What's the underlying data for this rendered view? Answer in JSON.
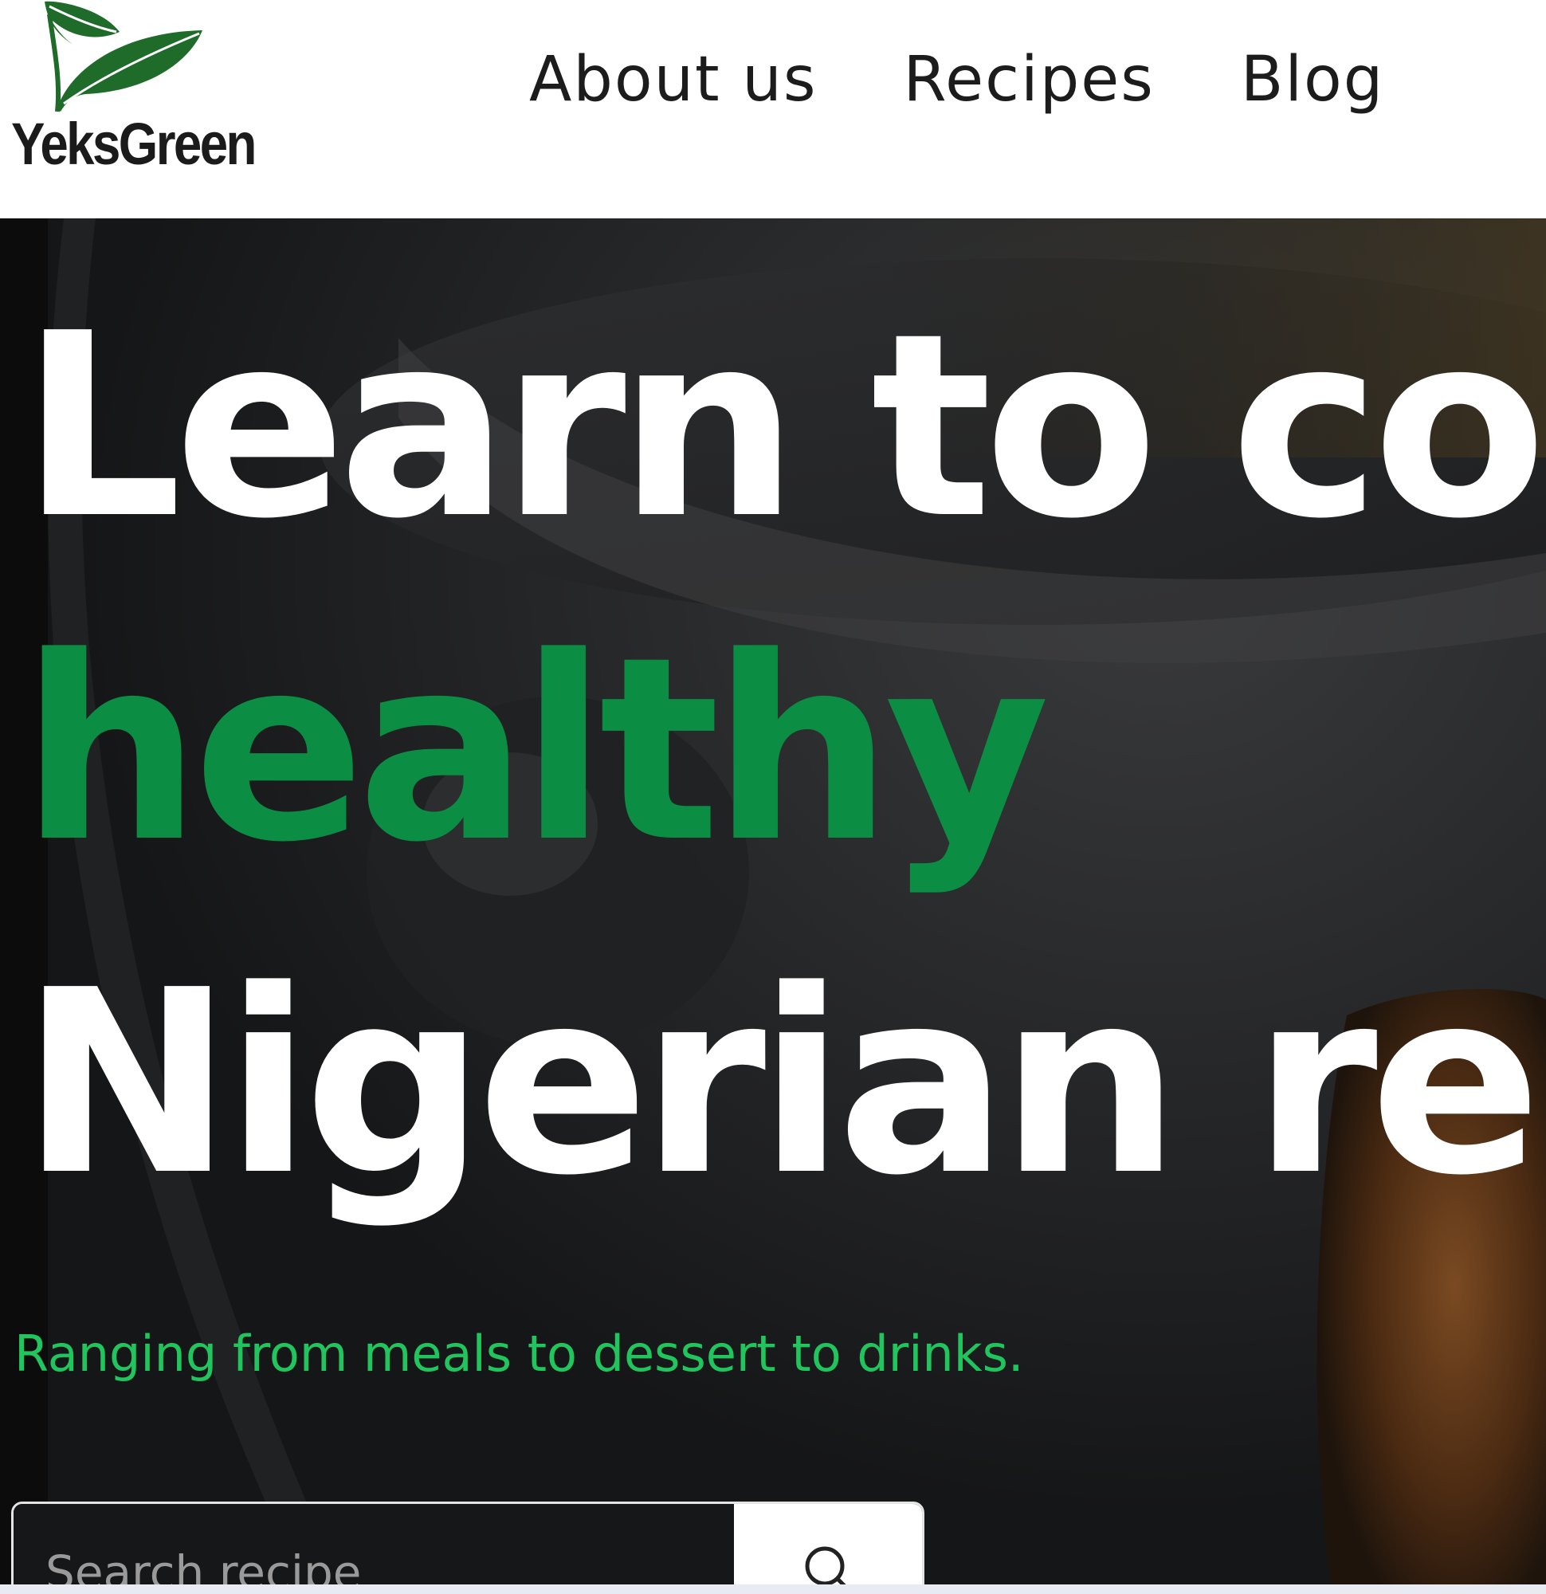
{
  "brand": {
    "name": "YeksGreen",
    "logo_icon": "leaves-icon",
    "accent_color": "#0b8e44"
  },
  "nav": {
    "items": [
      {
        "label": "About us"
      },
      {
        "label": "Recipes"
      },
      {
        "label": "Blog"
      }
    ]
  },
  "hero": {
    "headline_line1": "Learn to co",
    "headline_highlight": "healthy",
    "headline_line3": "Nigerian re",
    "subtext": "Ranging from meals to dessert to drinks.",
    "highlight_color": "#0b8e44",
    "subtext_color": "#20c55e"
  },
  "search": {
    "placeholder": "Search recipe",
    "button_icon": "search-icon"
  }
}
